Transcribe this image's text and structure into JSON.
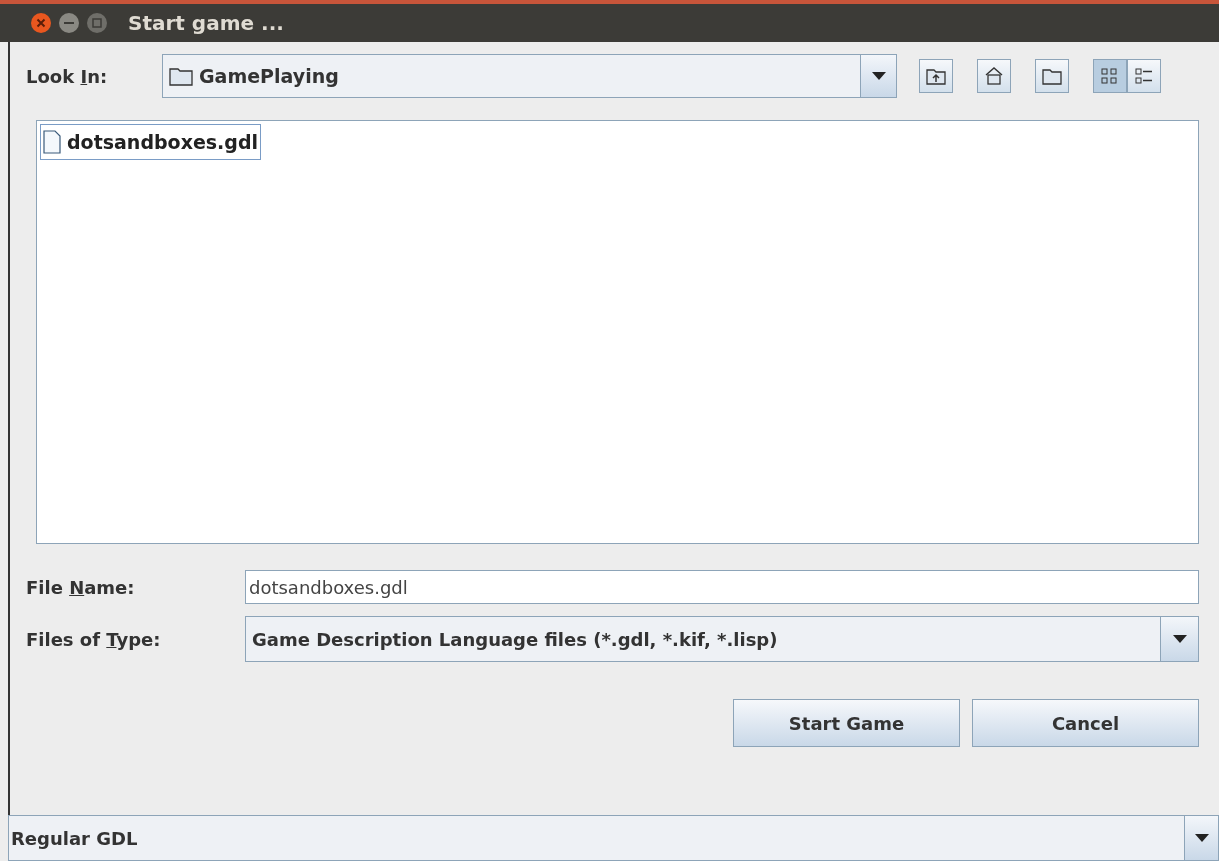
{
  "window": {
    "title": "Start game ..."
  },
  "look_in": {
    "label": [
      "Look ",
      "I",
      "n:"
    ],
    "value": "GamePlaying"
  },
  "toolbar": [
    {
      "kind": "up",
      "selected": false
    },
    {
      "kind": "home",
      "selected": false
    },
    {
      "kind": "new-folder",
      "selected": false
    },
    {
      "kind": "list",
      "selected": true
    },
    {
      "kind": "details",
      "selected": false
    }
  ],
  "files": [
    {
      "name": "dotsandboxes.gdl",
      "selected": true
    }
  ],
  "file_name": {
    "label": [
      "File ",
      "N",
      "ame:"
    ],
    "value": "dotsandboxes.gdl"
  },
  "file_type": {
    "label": [
      "Files of ",
      "T",
      "ype:"
    ],
    "value": "Game Description Language files (*.gdl, *.kif, *.lisp)"
  },
  "buttons": [
    "Start Game",
    "Cancel"
  ],
  "bottom_combo": {
    "value": "Regular GDL"
  }
}
